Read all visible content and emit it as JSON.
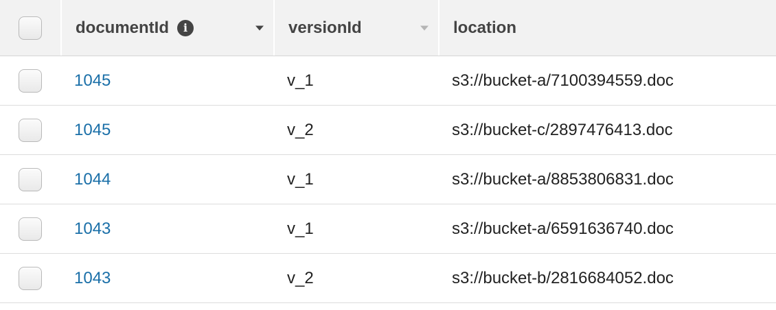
{
  "header": {
    "columns": {
      "documentId": "documentId",
      "versionId": "versionId",
      "location": "location"
    },
    "icons": {
      "info": "info-icon",
      "sort_active": "sort-desc-icon",
      "sort_inactive": "sort-icon"
    }
  },
  "rows": [
    {
      "documentId": "1045",
      "versionId": "v_1",
      "location": "s3://bucket-a/7100394559.doc",
      "selected": false
    },
    {
      "documentId": "1045",
      "versionId": "v_2",
      "location": "s3://bucket-c/2897476413.doc",
      "selected": false
    },
    {
      "documentId": "1044",
      "versionId": "v_1",
      "location": "s3://bucket-a/8853806831.doc",
      "selected": false
    },
    {
      "documentId": "1043",
      "versionId": "v_1",
      "location": "s3://bucket-a/6591636740.doc",
      "selected": false
    },
    {
      "documentId": "1043",
      "versionId": "v_2",
      "location": "s3://bucket-b/2816684052.doc",
      "selected": false
    }
  ],
  "colors": {
    "link": "#1a6fa8",
    "header_bg": "#f2f2f2",
    "text": "#222222"
  }
}
